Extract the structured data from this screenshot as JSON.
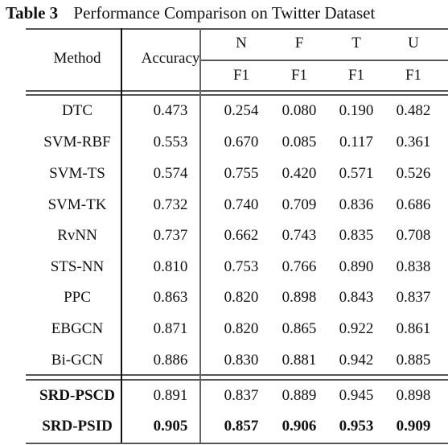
{
  "caption": {
    "label": "Table 3",
    "title": "Performance Comparison on Twitter Dataset"
  },
  "header": {
    "method": "Method",
    "accuracy": "Accuracy",
    "classes": [
      "N",
      "F",
      "T",
      "U"
    ],
    "metric": [
      "F1",
      "F1",
      "F1",
      "F1"
    ]
  },
  "rows": [
    {
      "method": "DTC",
      "accuracy": "0.473",
      "f1": [
        "0.254",
        "0.080",
        "0.190",
        "0.482"
      ],
      "bold_method": false,
      "bold_values": false
    },
    {
      "method": "SVM-RBF",
      "accuracy": "0.553",
      "f1": [
        "0.670",
        "0.085",
        "0.117",
        "0.361"
      ],
      "bold_method": false,
      "bold_values": false
    },
    {
      "method": "SVM-TS",
      "accuracy": "0.574",
      "f1": [
        "0.755",
        "0.420",
        "0.571",
        "0.526"
      ],
      "bold_method": false,
      "bold_values": false
    },
    {
      "method": "SVM-TK",
      "accuracy": "0.732",
      "f1": [
        "0.740",
        "0.709",
        "0.836",
        "0.686"
      ],
      "bold_method": false,
      "bold_values": false
    },
    {
      "method": "RvNN",
      "accuracy": "0.737",
      "f1": [
        "0.662",
        "0.743",
        "0.835",
        "0.708"
      ],
      "bold_method": false,
      "bold_values": false
    },
    {
      "method": "STS-NN",
      "accuracy": "0.810",
      "f1": [
        "0.753",
        "0.766",
        "0.890",
        "0.838"
      ],
      "bold_method": false,
      "bold_values": false
    },
    {
      "method": "PPC",
      "accuracy": "0.863",
      "f1": [
        "0.820",
        "0.898",
        "0.843",
        "0.837"
      ],
      "bold_method": false,
      "bold_values": false
    },
    {
      "method": "EBGCN",
      "accuracy": "0.871",
      "f1": [
        "0.820",
        "0.865",
        "0.922",
        "0.861"
      ],
      "bold_method": false,
      "bold_values": false
    },
    {
      "method": "Bi-GCN",
      "accuracy": "0.886",
      "f1": [
        "0.830",
        "0.881",
        "0.942",
        "0.885"
      ],
      "bold_method": false,
      "bold_values": false
    },
    {
      "method": "SRD-PSCD",
      "accuracy": "0.891",
      "f1": [
        "0.837",
        "0.889",
        "0.945",
        "0.898"
      ],
      "bold_method": true,
      "bold_values": false
    },
    {
      "method": "SRD-PSID",
      "accuracy": "0.905",
      "f1": [
        "0.857",
        "0.906",
        "0.953",
        "0.909"
      ],
      "bold_method": true,
      "bold_values": true
    }
  ]
}
